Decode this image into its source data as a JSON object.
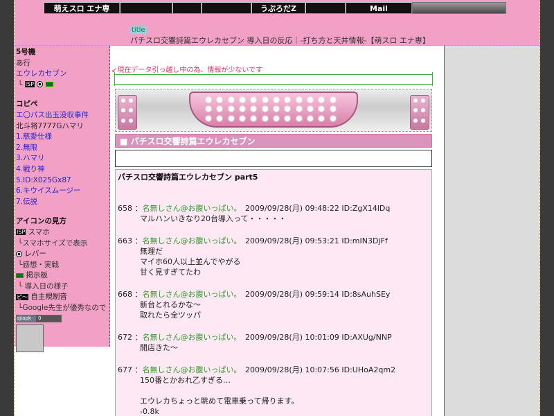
{
  "header": {
    "nav": [
      "萌えスロ エナ専",
      "",
      "",
      "",
      "うぷろだZ",
      "",
      "Mail"
    ],
    "title_tag": "title",
    "page_title": "パチスロ交響詩篇エウレカセブン 導入日の反応｜-打ち方と天井情報-【萌スロ エナ専】"
  },
  "sidebar": {
    "model_heading": "5号機",
    "model_row": "あ行",
    "model_link": "エウレカセブン",
    "copipe_heading": "コピペ",
    "copipe_items": [
      "エ〇パス出玉没収事件",
      "北斗将7777Gハマリ",
      "1.慈愛仕様",
      "2.無限",
      "3.ハマリ",
      "4.戦り神",
      "5.ID:X025Gx87",
      "6.キウイスムージー",
      "7.伝説"
    ],
    "icon_heading": "アイコンの見方",
    "icon_legend": [
      {
        "badge": "ISP",
        "label": "スマホ"
      },
      {
        "tree": "└",
        "label": "スマホサイズで表示"
      },
      {
        "badge": "lever",
        "label": "レバー"
      },
      {
        "tree": "└",
        "label": "感想・実戦"
      },
      {
        "badge": "board",
        "label": "掲示板"
      },
      {
        "tree": "└",
        "label": "導入日の様子"
      },
      {
        "badge": "ピ〜",
        "label": "自主規制音"
      },
      {
        "tree": "└",
        "label": "Google先生が優秀なので"
      }
    ],
    "counter_left": "ajiapk",
    "counter_right": "0"
  },
  "notice": "↙現在データ引っ越し中の為、情報が少ないです",
  "section_title": "■ パチスロ交響詩篇エウレカセブン",
  "content": {
    "heading": "パチスロ交響詩篇エウレカセブン part5",
    "posts": [
      {
        "no": "658",
        "name": "名無しさん@お腹いっぱい。",
        "meta": "2009/09/28(月) 09:48:22 ID:ZgX14lDq",
        "lines": [
          "マルハンいきなり20台導入って・・・・・"
        ]
      },
      {
        "no": "663",
        "name": "名無しさん@お腹いっぱい。",
        "meta": "2009/09/28(月) 09:53:21 ID:mIN3DjFf",
        "lines": [
          "無理だ",
          "マイホ60人以上並んでやがる",
          "甘く見すぎてたわ"
        ]
      },
      {
        "no": "668",
        "name": "名無しさん@お腹いっぱい。",
        "meta": "2009/09/28(月) 09:59:14 ID:8sAuhSEy",
        "lines": [
          "新台とれるかな～",
          "取れたら全ツッパ"
        ]
      },
      {
        "no": "672",
        "name": "名無しさん@お腹いっぱい。",
        "meta": "2009/09/28(月) 10:01:09 ID:AXUg/NNP",
        "lines": [
          "開店きた～"
        ]
      },
      {
        "no": "677",
        "name": "名無しさん@お腹いっぱい。",
        "meta": "2009/09/28(月) 10:07:56 ID:UHoA2qm2",
        "lines": [
          "150番とかおれ乙すぎる…",
          "",
          "エウレカちょっと眺めて電車乗って帰ります。",
          "-0.8k"
        ]
      }
    ]
  }
}
